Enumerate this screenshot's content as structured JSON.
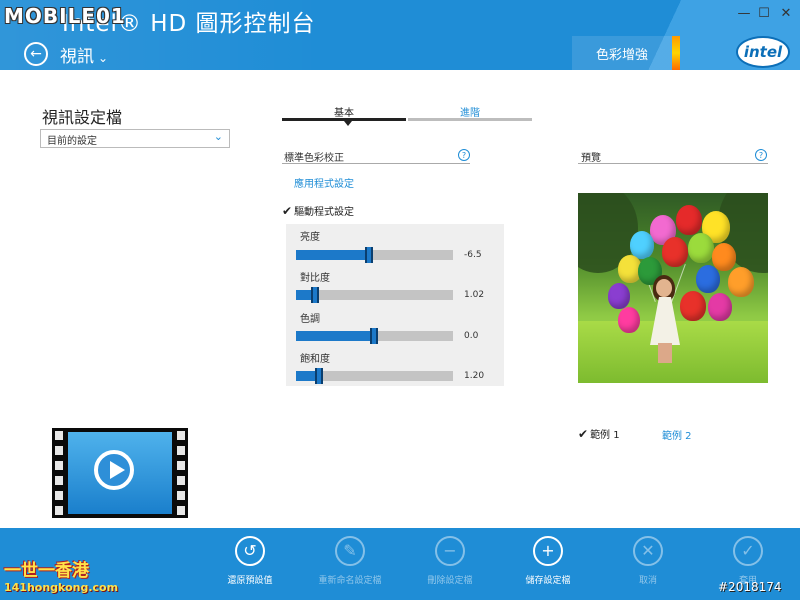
{
  "header": {
    "app_title": "Intel® HD 圖形控制台",
    "section": "視訊",
    "section_chevron": "⌄",
    "tab_color_enhance": "色彩增強",
    "intel_logo": "intel",
    "window_controls": {
      "minimize": "—",
      "maximize": "☐",
      "close": "✕"
    },
    "background_color": "#1f8dd6"
  },
  "left_panel": {
    "profile_title": "視訊設定檔",
    "profile_select_value": "目前的設定"
  },
  "tabs": [
    {
      "label": "基本",
      "active": true
    },
    {
      "label": "進階",
      "active": false
    }
  ],
  "calibration": {
    "title": "標準色彩校正",
    "app_settings_link": "應用程式設定",
    "driver_settings_label": "驅動程式設定",
    "driver_settings_checked": true,
    "help_glyph": "?",
    "sliders": [
      {
        "label": "亮度",
        "value": "-6.5",
        "level": 0.47
      },
      {
        "label": "對比度",
        "value": "1.02",
        "level": 0.13
      },
      {
        "label": "色調",
        "value": "0.0",
        "level": 0.5
      },
      {
        "label": "飽和度",
        "value": "1.20",
        "level": 0.15
      }
    ]
  },
  "preview": {
    "title": "預覽",
    "examples": [
      {
        "label": "範例 1",
        "checked": true
      },
      {
        "label": "範例 2",
        "checked": false
      }
    ]
  },
  "bottom_bar": {
    "buttons": [
      {
        "label": "還原預設值",
        "icon": "undo-icon",
        "glyph": "↺",
        "enabled": true
      },
      {
        "label": "重新命名設定檔",
        "icon": "pencil-icon",
        "glyph": "✎",
        "enabled": false
      },
      {
        "label": "刪除設定檔",
        "icon": "minus-icon",
        "glyph": "−",
        "enabled": false
      },
      {
        "label": "儲存設定檔",
        "icon": "plus-icon",
        "glyph": "+",
        "enabled": true
      },
      {
        "label": "取消",
        "icon": "close-icon",
        "glyph": "✕",
        "enabled": false
      },
      {
        "label": "套用",
        "icon": "check-icon",
        "glyph": "✓",
        "enabled": false
      }
    ]
  },
  "watermarks": {
    "mobile01": "MOBILE01",
    "hk_line1": "一世一香港",
    "hk_line2": "141hongkong.com",
    "post_id": "#2018174"
  }
}
